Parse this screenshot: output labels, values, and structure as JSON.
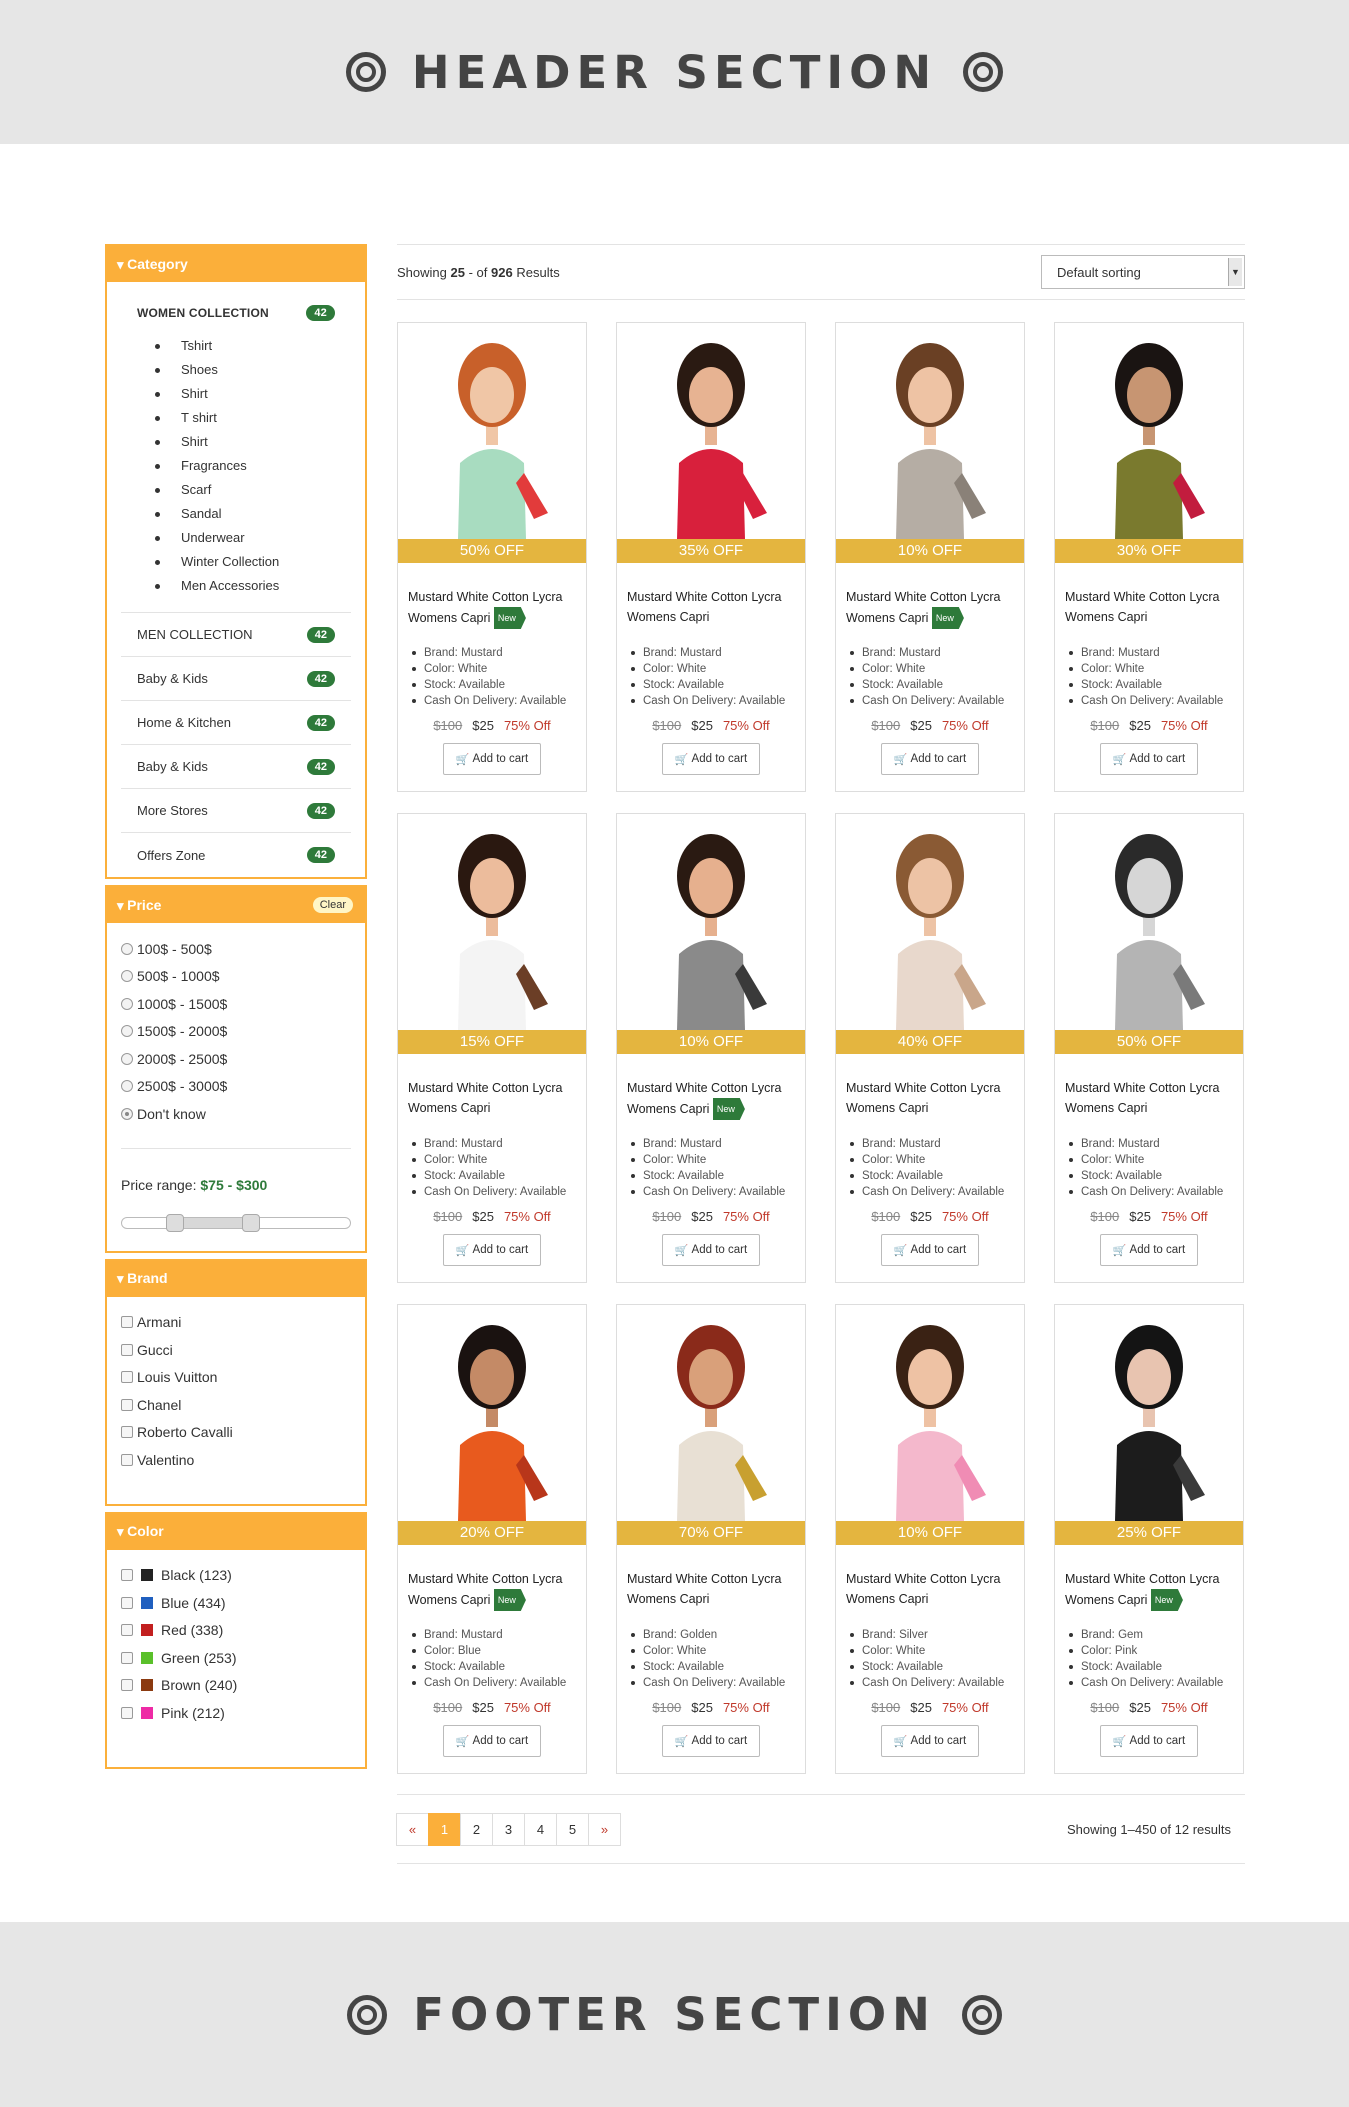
{
  "header": {
    "title": "HEADER SECTION"
  },
  "footer": {
    "title": "FOOTER SECTION"
  },
  "sidebar": {
    "category": {
      "title": "Category",
      "women": {
        "label": "WOMEN COLLECTION",
        "count": "42",
        "items": [
          "Tshirt",
          "Shoes",
          "Shirt",
          "T shirt",
          "Shirt",
          "Fragrances",
          "Scarf",
          "Sandal",
          "Underwear",
          "Winter Collection",
          "Men Accessories"
        ]
      },
      "rows": [
        {
          "label": "MEN COLLECTION",
          "count": "42"
        },
        {
          "label": "Baby & Kids",
          "count": "42"
        },
        {
          "label": "Home & Kitchen",
          "count": "42"
        },
        {
          "label": "Baby & Kids",
          "count": "42"
        },
        {
          "label": "More Stores",
          "count": "42"
        },
        {
          "label": "Offers Zone",
          "count": "42"
        }
      ]
    },
    "price": {
      "title": "Price",
      "clear": "Clear",
      "options": [
        "100$ - 500$",
        "500$ - 1000$",
        "1000$ - 1500$",
        "1500$ - 2000$",
        "2000$ - 2500$",
        "2500$ - 3000$",
        "Don't know"
      ],
      "selected_index": 6,
      "range_label": "Price range:",
      "range_value": "$75 - $300",
      "range_min_fraction": 0.15,
      "range_max_fraction": 0.6
    },
    "brand": {
      "title": "Brand",
      "options": [
        "Armani",
        "Gucci",
        "Louis Vuitton",
        "Chanel",
        "Roberto Cavalli",
        "Valentino"
      ]
    },
    "color": {
      "title": "Color",
      "options": [
        {
          "label": "Black (123)",
          "color": "#222222"
        },
        {
          "label": "Blue (434)",
          "color": "#1f5fbf"
        },
        {
          "label": "Red (338)",
          "color": "#c21f1f"
        },
        {
          "label": "Green (253)",
          "color": "#5ac02a"
        },
        {
          "label": "Brown (240)",
          "color": "#8b3a10"
        },
        {
          "label": "Pink (212)",
          "color": "#ee2aa5"
        }
      ]
    }
  },
  "toolbar": {
    "showing_prefix": "Showing",
    "showing_count": "25",
    "showing_mid": "- of",
    "showing_total": "926",
    "showing_suffix": "Results",
    "sort_value": "Default sorting"
  },
  "products": [
    {
      "off": "50% OFF",
      "name": "Mustard White Cotton Lycra Womens Capri",
      "is_new": true,
      "brand": "Brand: Mustard",
      "color": "Color: White",
      "stock": "Stock: Available",
      "cod": "Cash On Delivery: Available",
      "old": "$100",
      "price": "$25",
      "discount": "75% Off",
      "cart": "Add to cart",
      "skin": "#f0c6a6",
      "hair": "#c8602a",
      "top": "#a8dcc0",
      "accent": "#e23b3b"
    },
    {
      "off": "35% OFF",
      "name": "Mustard White Cotton Lycra Womens Capri",
      "is_new": false,
      "brand": "Brand: Mustard",
      "color": "Color: White",
      "stock": "Stock: Available",
      "cod": "Cash On Delivery: Available",
      "old": "$100",
      "price": "$25",
      "discount": "75% Off",
      "cart": "Add to cart",
      "skin": "#e7b392",
      "hair": "#2a1a12",
      "top": "#d8203c",
      "accent": "#d8203c"
    },
    {
      "off": "10% OFF",
      "name": "Mustard White Cotton Lycra Womens Capri",
      "is_new": true,
      "brand": "Brand: Mustard",
      "color": "Color: White",
      "stock": "Stock: Available",
      "cod": "Cash On Delivery: Available",
      "old": "$100",
      "price": "$25",
      "discount": "75% Off",
      "cart": "Add to cart",
      "skin": "#eec3a4",
      "hair": "#6a4024",
      "top": "#b5ada4",
      "accent": "#8a8178"
    },
    {
      "off": "30% OFF",
      "name": "Mustard White Cotton Lycra Womens Capri",
      "is_new": false,
      "brand": "Brand: Mustard",
      "color": "Color: White",
      "stock": "Stock: Available",
      "cod": "Cash On Delivery: Available",
      "old": "$100",
      "price": "$25",
      "discount": "75% Off",
      "cart": "Add to cart",
      "skin": "#c79572",
      "hair": "#1a1412",
      "top": "#7a7a2e",
      "accent": "#c21c3e"
    },
    {
      "off": "15% OFF",
      "name": "Mustard White Cotton Lycra Womens Capri",
      "is_new": false,
      "brand": "Brand: Mustard",
      "color": "Color: White",
      "stock": "Stock: Available",
      "cod": "Cash On Delivery: Available",
      "old": "$100",
      "price": "$25",
      "discount": "75% Off",
      "cart": "Add to cart",
      "skin": "#ecbc9c",
      "hair": "#2a1810",
      "top": "#f4f4f4",
      "accent": "#6b3e26"
    },
    {
      "off": "10% OFF",
      "name": "Mustard White Cotton Lycra Womens Capri",
      "is_new": true,
      "brand": "Brand: Mustard",
      "color": "Color: White",
      "stock": "Stock: Available",
      "cod": "Cash On Delivery: Available",
      "old": "$100",
      "price": "$25",
      "discount": "75% Off",
      "cart": "Add to cart",
      "skin": "#e6b08e",
      "hair": "#2a1a12",
      "top": "#8a8a8a",
      "accent": "#3a3a3a"
    },
    {
      "off": "40% OFF",
      "name": "Mustard White Cotton Lycra Womens Capri",
      "is_new": false,
      "brand": "Brand: Mustard",
      "color": "Color: White",
      "stock": "Stock: Available",
      "cod": "Cash On Delivery: Available",
      "old": "$100",
      "price": "$25",
      "discount": "75% Off",
      "cart": "Add to cart",
      "skin": "#edc3a5",
      "hair": "#8a5a34",
      "top": "#e8d8cc",
      "accent": "#c9a68a"
    },
    {
      "off": "50% OFF",
      "name": "Mustard White Cotton Lycra Womens Capri",
      "is_new": false,
      "brand": "Brand: Mustard",
      "color": "Color: White",
      "stock": "Stock: Available",
      "cod": "Cash On Delivery: Available",
      "old": "$100",
      "price": "$25",
      "discount": "75% Off",
      "cart": "Add to cart",
      "skin": "#d6d6d6",
      "hair": "#2a2a2a",
      "top": "#b4b4b4",
      "accent": "#7a7a7a"
    },
    {
      "off": "20% OFF",
      "name": "Mustard White Cotton Lycra Womens Capri",
      "is_new": true,
      "brand": "Brand: Mustard",
      "color": "Color: Blue",
      "stock": "Stock: Available",
      "cod": "Cash On Delivery: Available",
      "old": "$100",
      "price": "$25",
      "discount": "75% Off",
      "cart": "Add to cart",
      "skin": "#c48a66",
      "hair": "#1a1210",
      "top": "#e85a1e",
      "accent": "#b8361a"
    },
    {
      "off": "70% OFF",
      "name": "Mustard White Cotton Lycra Womens Capri",
      "is_new": false,
      "brand": "Brand: Golden",
      "color": "Color: White",
      "stock": "Stock: Available",
      "cod": "Cash On Delivery: Available",
      "old": "$100",
      "price": "$25",
      "discount": "75% Off",
      "cart": "Add to cart",
      "skin": "#d9a07a",
      "hair": "#8a2a1a",
      "top": "#e8e0d4",
      "accent": "#c8a030"
    },
    {
      "off": "10% OFF",
      "name": "Mustard White Cotton Lycra Womens Capri",
      "is_new": false,
      "brand": "Brand: Silver",
      "color": "Color: White",
      "stock": "Stock: Available",
      "cod": "Cash On Delivery: Available",
      "old": "$100",
      "price": "$25",
      "discount": "75% Off",
      "cart": "Add to cart",
      "skin": "#eec2a4",
      "hair": "#3a2214",
      "top": "#f4b8cc",
      "accent": "#f08cb4"
    },
    {
      "off": "25% OFF",
      "name": "Mustard White Cotton Lycra Womens Capri",
      "is_new": true,
      "brand": "Brand: Gem",
      "color": "Color: Pink",
      "stock": "Stock: Available",
      "cod": "Cash On Delivery: Available",
      "old": "$100",
      "price": "$25",
      "discount": "75% Off",
      "cart": "Add to cart",
      "skin": "#e8c4b0",
      "hair": "#141414",
      "top": "#1c1c1c",
      "accent": "#3a3a3a"
    }
  ],
  "new_label": "New",
  "pagination": {
    "prev": "«",
    "pages": [
      "1",
      "2",
      "3",
      "4",
      "5"
    ],
    "current": "1",
    "next": "»",
    "summary": "Showing 1–450 of 12 results"
  }
}
